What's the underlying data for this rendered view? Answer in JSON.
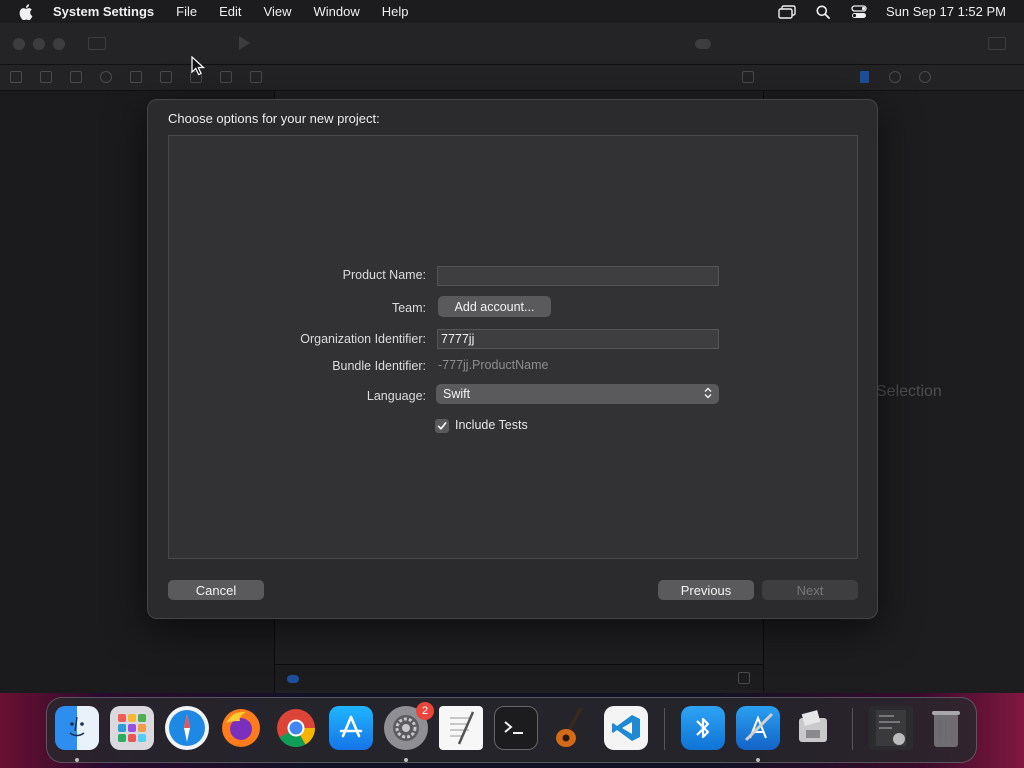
{
  "menubar": {
    "app_name": "System Settings",
    "items": [
      "File",
      "Edit",
      "View",
      "Window",
      "Help"
    ],
    "clock": "Sun Sep 17  1:52 PM"
  },
  "background": {
    "no_selection_text": "Selection"
  },
  "dialog": {
    "title": "Choose options for your new project:",
    "fields": {
      "product_name_label": "Product Name:",
      "product_name_value": "",
      "team_label": "Team:",
      "add_account_label": "Add account...",
      "org_identifier_label": "Organization Identifier:",
      "org_identifier_value": "7777jj",
      "bundle_identifier_label": "Bundle Identifier:",
      "bundle_identifier_value": "-777jj.ProductName",
      "language_label": "Language:",
      "language_value": "Swift",
      "include_tests_label": "Include Tests",
      "include_tests_checked": true
    },
    "buttons": {
      "cancel": "Cancel",
      "previous": "Previous",
      "next": "Next"
    }
  },
  "dock": {
    "apps": [
      "finder",
      "launchpad",
      "safari",
      "firefox",
      "chrome",
      "app-store",
      "system-settings",
      "textedit",
      "terminal",
      "garageband",
      "vscode",
      "bluetooth-file-exchange",
      "xcode",
      "boot-camp",
      "downloads-stack",
      "trash"
    ],
    "system_settings_badge": "2"
  }
}
